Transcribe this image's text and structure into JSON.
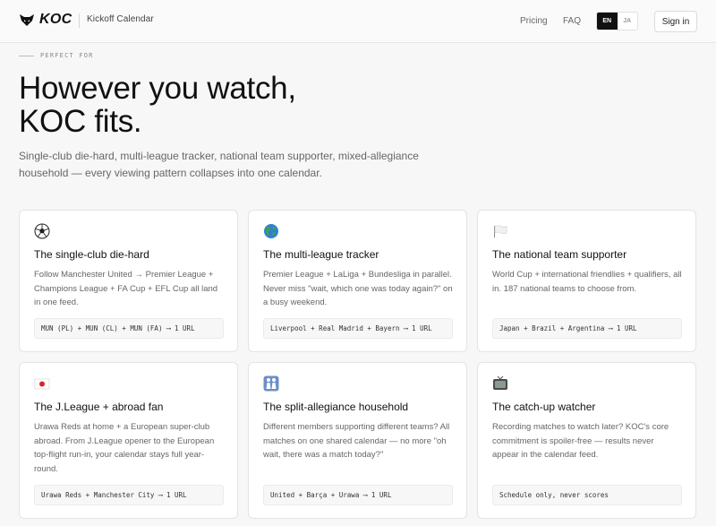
{
  "header": {
    "logo_text": "KOC",
    "app_name": "Kickoff Calendar",
    "nav": [
      {
        "label": "Pricing"
      },
      {
        "label": "FAQ"
      }
    ],
    "languages": [
      {
        "label": "EN",
        "active": true
      },
      {
        "label": "JA",
        "active": false
      }
    ],
    "signin_label": "Sign in"
  },
  "hero": {
    "eyebrow": "PERFECT FOR",
    "title_line1": "However you watch,",
    "title_line2": "KOC fits.",
    "subtitle": "Single-club die-hard, multi-league tracker, national team supporter, mixed-allegiance household — every viewing pattern collapses into one calendar."
  },
  "cards": [
    {
      "icon": "soccer-ball-icon",
      "title": "The single-club die-hard",
      "description": "Follow Manchester United → Premier League + Champions League + FA Cup + EFL Cup all land in one feed.",
      "code": "MUN (PL) + MUN (CL) + MUN (FA) ⟶ 1 URL"
    },
    {
      "icon": "globe-icon",
      "title": "The multi-league tracker",
      "description": "Premier League + LaLiga + Bundesliga in parallel. Never miss \"wait, which one was today again?\" on a busy weekend.",
      "code": "Liverpool + Real Madrid + Bayern ⟶ 1 URL"
    },
    {
      "icon": "white-flag-icon",
      "title": "The national team supporter",
      "description": "World Cup + international friendlies + qualifiers, all in. 187 national teams to choose from.",
      "code": "Japan + Brazil + Argentina ⟶ 1 URL"
    },
    {
      "icon": "japan-flag-icon",
      "title": "The J.League + abroad fan",
      "description": "Urawa Reds at home + a European super-club abroad. From J.League opener to the European top-flight run-in, your calendar stays full year-round.",
      "code": "Urawa Reds + Manchester City ⟶ 1 URL"
    },
    {
      "icon": "family-icon",
      "title": "The split-allegiance household",
      "description": "Different members supporting different teams? All matches on one shared calendar — no more \"oh wait, there was a match today?\"",
      "code": "United + Barça + Urawa ⟶ 1 URL"
    },
    {
      "icon": "television-icon",
      "title": "The catch-up watcher",
      "description": "Recording matches to watch later? KOC's core commitment is spoiler-free — results never appear in the calendar feed.",
      "code": "Schedule only, never scores"
    }
  ]
}
